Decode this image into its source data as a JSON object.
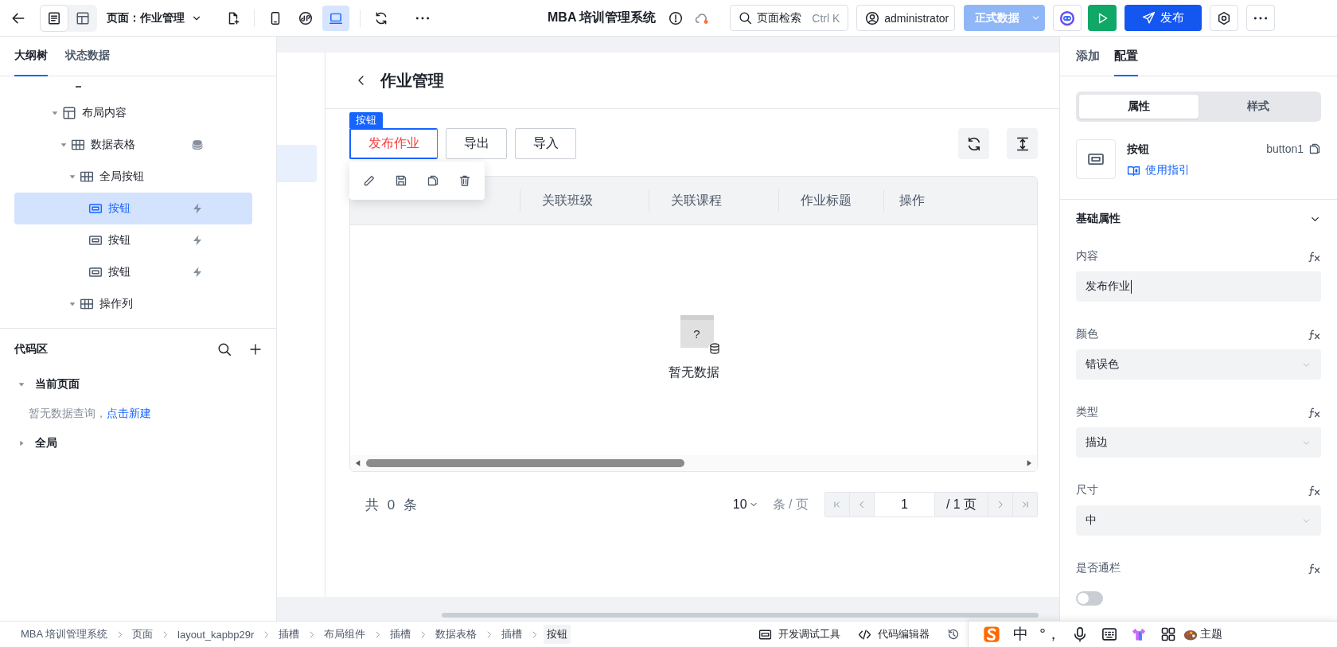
{
  "top_bar": {
    "view_modes": [
      {
        "kind": "outline",
        "selected": true
      },
      {
        "kind": "layout",
        "selected": false
      }
    ],
    "page_selector": "页面：作业管理",
    "devices": [
      {
        "kind": "mobile",
        "selected": false
      },
      {
        "kind": "miniapp",
        "selected": false
      },
      {
        "kind": "desktop",
        "selected": true
      }
    ],
    "app_title": "MBA 培训管理系统",
    "search": {
      "label": "页面检索",
      "shortcut": "Ctrl K"
    },
    "user": "administrator",
    "environment": "正式数据",
    "publish": "发布"
  },
  "outline_panel": {
    "tabs": [
      {
        "label": "大纲树",
        "selected": true
      },
      {
        "label": "状态数据",
        "selected": false
      }
    ],
    "tree": [
      {
        "label": "布局内容",
        "kind": "layout",
        "expanded": true,
        "selected": false,
        "children": [
          {
            "label": "数据表格",
            "kind": "table",
            "expanded": true,
            "selected": false,
            "data_bound": true,
            "children": [
              {
                "label": "全局按钮",
                "kind": "table",
                "expanded": true,
                "selected": false,
                "children": [
                  {
                    "label": "按钮",
                    "kind": "button",
                    "selected": true,
                    "has_events": true
                  },
                  {
                    "label": "按钮",
                    "kind": "button",
                    "selected": false,
                    "has_events": true
                  },
                  {
                    "label": "按钮",
                    "kind": "button",
                    "selected": false,
                    "has_events": true
                  }
                ]
              },
              {
                "label": "操作列",
                "kind": "table",
                "expanded": true,
                "selected": false
              }
            ]
          }
        ]
      }
    ]
  },
  "code_area": {
    "title": "代码区",
    "sections": [
      {
        "label": "当前页面",
        "expanded": true,
        "empty_text": "暂无数据查询，",
        "link": "点击新建"
      },
      {
        "label": "全局",
        "expanded": false
      }
    ]
  },
  "canvas": {
    "page_title": "作业管理",
    "selection_tag": "按钮",
    "buttons": [
      {
        "label": "发布作业",
        "kind": "danger",
        "selected": true
      },
      {
        "label": "导出",
        "kind": "default",
        "selected": false
      },
      {
        "label": "导入",
        "kind": "default",
        "selected": false
      }
    ],
    "table": {
      "columns": [
        "关联班级",
        "关联课程",
        "作业标题",
        "操作"
      ],
      "empty_glyph": "?",
      "empty_text": "暂无数据"
    },
    "pagination": {
      "total": "共 0 条",
      "page_size": "10",
      "page_size_unit": "条 / 页",
      "current_page": "1",
      "page_count": "/ 1 页"
    }
  },
  "config_panel": {
    "tabs": [
      {
        "label": "添加",
        "selected": false
      },
      {
        "label": "配置",
        "selected": true
      }
    ],
    "segments": [
      {
        "label": "属性",
        "selected": true
      },
      {
        "label": "样式",
        "selected": false
      }
    ],
    "component": {
      "name": "按钮",
      "guide_link": "使用指引",
      "id": "button1"
    },
    "section": {
      "title": "基础属性",
      "expanded": true
    },
    "fields": [
      {
        "label": "内容",
        "kind": "text",
        "value": "发布作业"
      },
      {
        "label": "颜色",
        "kind": "select",
        "value": "错误色"
      },
      {
        "label": "类型",
        "kind": "select",
        "value": "描边"
      },
      {
        "label": "尺寸",
        "kind": "select",
        "value": "中"
      },
      {
        "label": "是否通栏",
        "kind": "toggle",
        "on": false
      }
    ]
  },
  "status_bar": {
    "breadcrumb": [
      {
        "label": "MBA 培训管理系统",
        "selected": false
      },
      {
        "label": "页面",
        "selected": false
      },
      {
        "label": "layout_kapbp29r",
        "selected": false
      },
      {
        "label": "插槽",
        "selected": false
      },
      {
        "label": "布局组件",
        "selected": false
      },
      {
        "label": "插槽",
        "selected": false
      },
      {
        "label": "数据表格",
        "selected": false
      },
      {
        "label": "插槽",
        "selected": false
      },
      {
        "label": "按钮",
        "selected": true
      }
    ],
    "tools": [
      {
        "label": "开发调试工具",
        "kind": "debug"
      },
      {
        "label": "代码编辑器",
        "kind": "code"
      }
    ]
  },
  "ime_toolbar": [
    {
      "kind": "logo"
    },
    {
      "kind": "text",
      "label": "中"
    },
    {
      "kind": "text",
      "label": "°，"
    },
    {
      "kind": "mic"
    },
    {
      "kind": "keyboard"
    },
    {
      "kind": "skin"
    },
    {
      "kind": "apps"
    },
    {
      "kind": "theme",
      "label": "主题"
    }
  ]
}
